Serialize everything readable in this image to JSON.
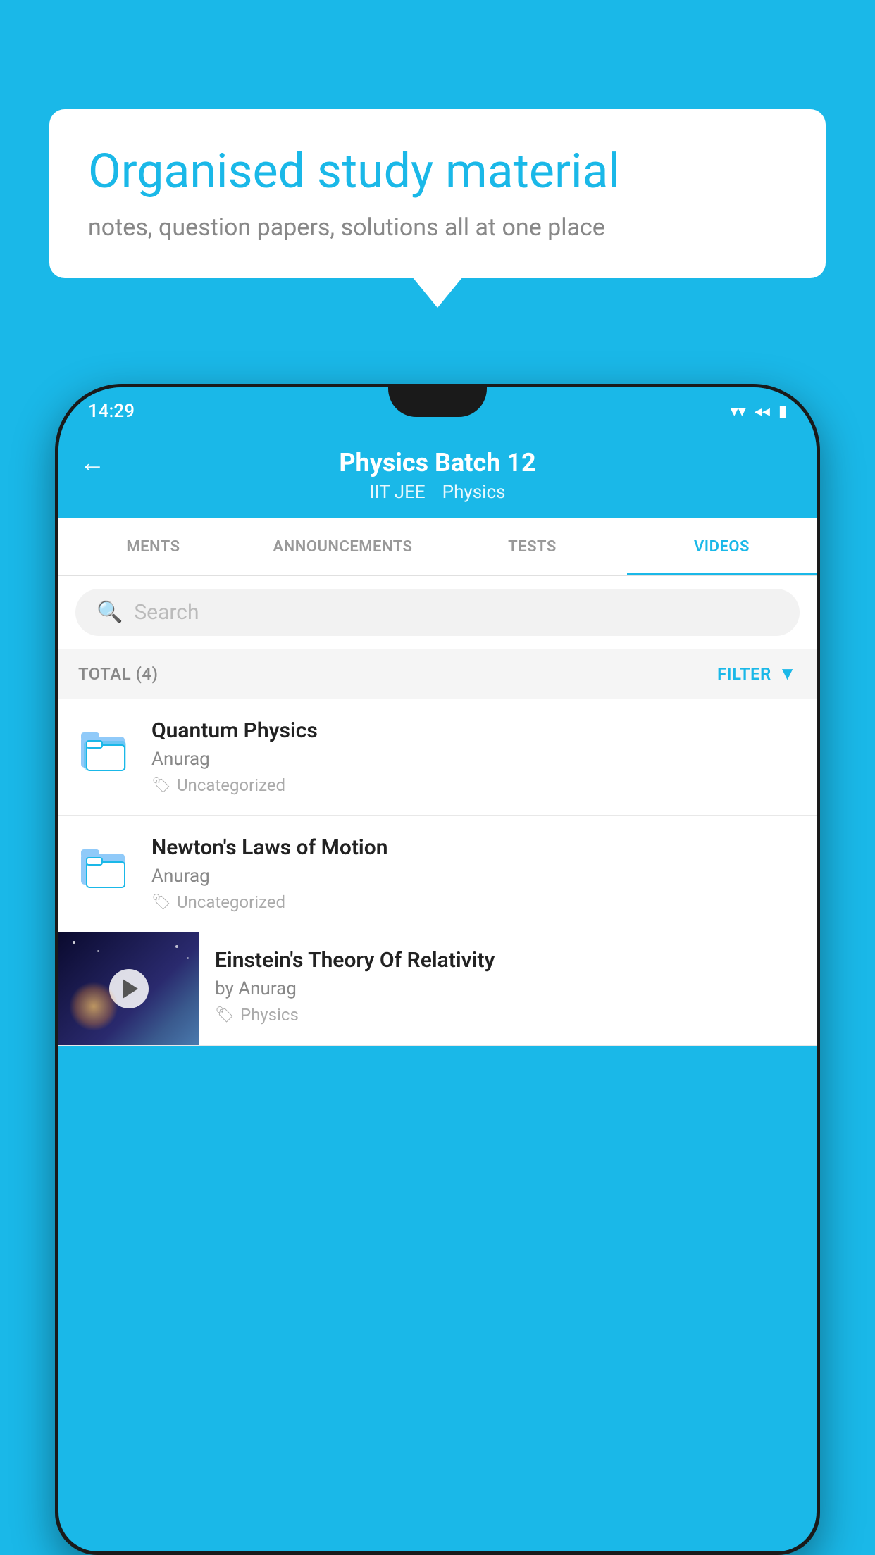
{
  "background": {
    "color": "#1ab8e8"
  },
  "speech_bubble": {
    "title": "Organised study material",
    "subtitle": "notes, question papers, solutions all at one place"
  },
  "status_bar": {
    "time": "14:29",
    "wifi_icon": "▾",
    "signal_icon": "◂",
    "battery_icon": "▮"
  },
  "app_bar": {
    "title": "Physics Batch 12",
    "tag1": "IIT JEE",
    "tag2": "Physics",
    "back_label": "←"
  },
  "tabs": [
    {
      "label": "MENTS",
      "active": false
    },
    {
      "label": "ANNOUNCEMENTS",
      "active": false
    },
    {
      "label": "TESTS",
      "active": false
    },
    {
      "label": "VIDEOS",
      "active": true
    }
  ],
  "search": {
    "placeholder": "Search"
  },
  "filter": {
    "total_label": "TOTAL (4)",
    "filter_label": "FILTER"
  },
  "items": [
    {
      "title": "Quantum Physics",
      "author": "Anurag",
      "tag": "Uncategorized",
      "type": "folder"
    },
    {
      "title": "Newton's Laws of Motion",
      "author": "Anurag",
      "tag": "Uncategorized",
      "type": "folder"
    },
    {
      "title": "Einstein's Theory Of Relativity",
      "author": "by Anurag",
      "tag": "Physics",
      "type": "video"
    }
  ]
}
